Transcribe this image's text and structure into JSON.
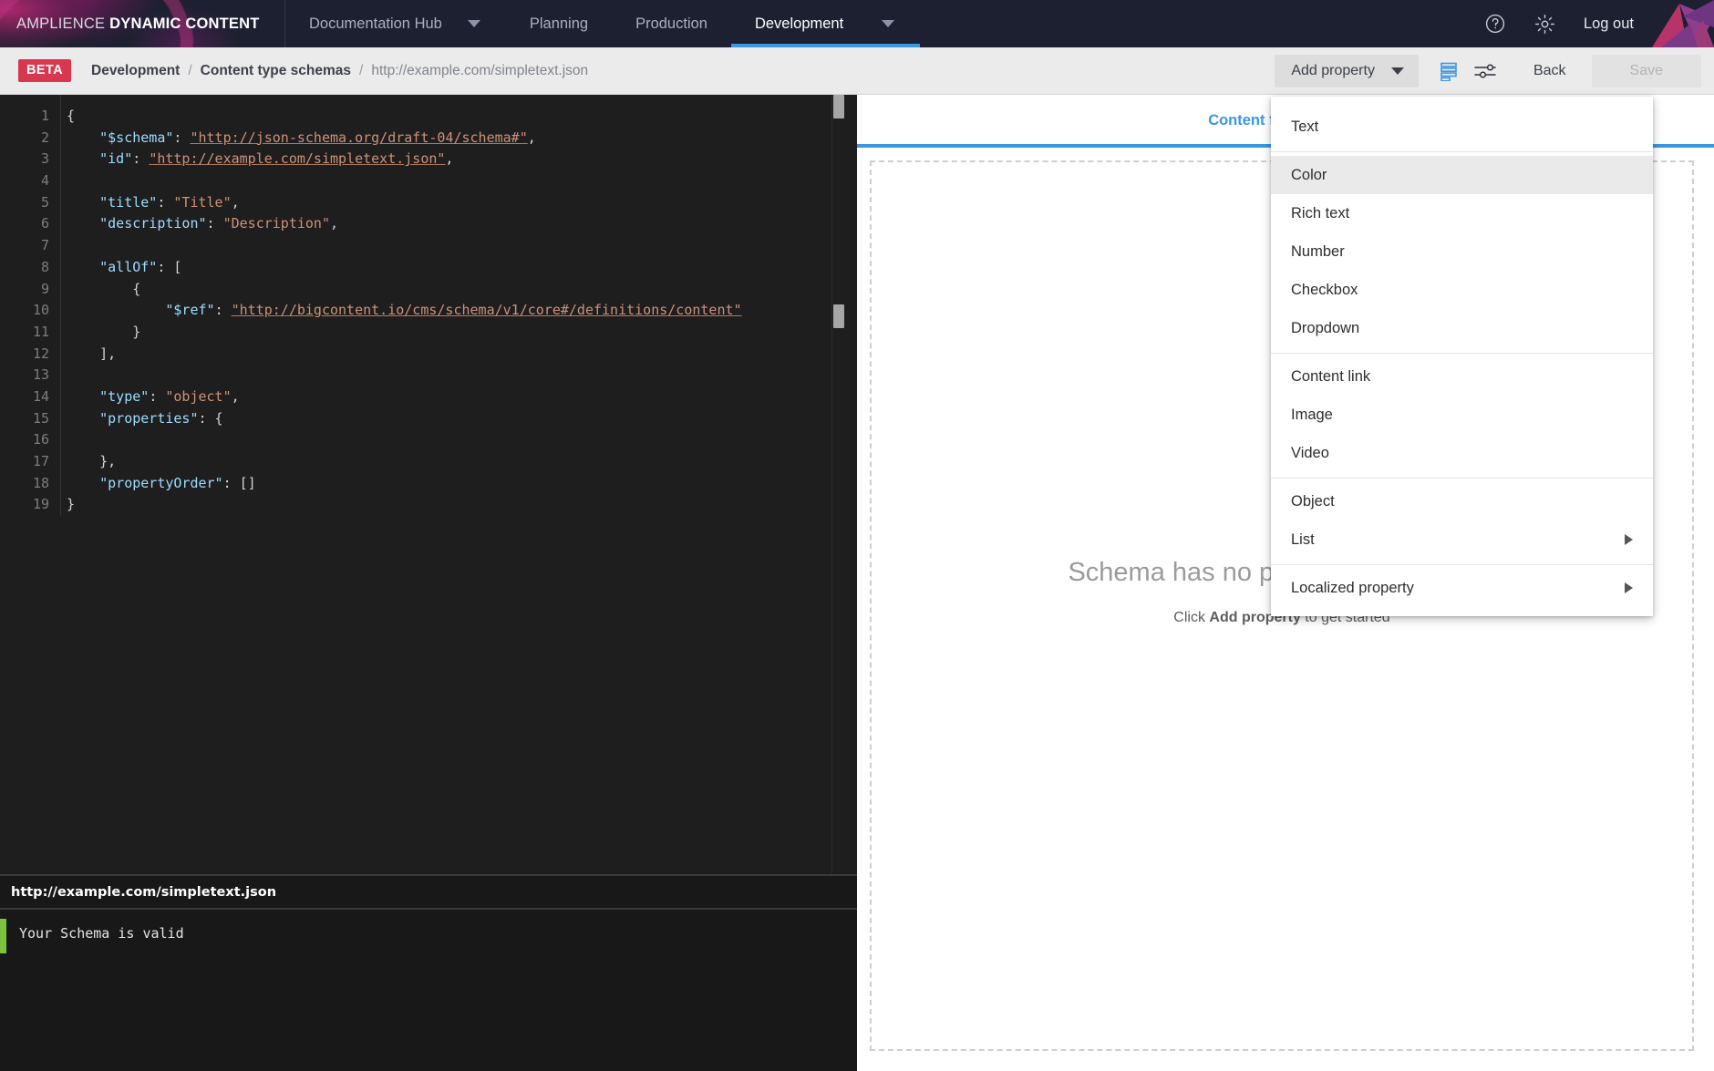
{
  "topnav": {
    "brand_thin": "AMPLIENCE",
    "brand_bold": "DYNAMIC CONTENT",
    "items": [
      {
        "label": "Documentation Hub",
        "active": false,
        "caret": true
      },
      {
        "label": "Planning",
        "active": false,
        "caret": false
      },
      {
        "label": "Production",
        "active": false,
        "caret": false
      },
      {
        "label": "Development",
        "active": true,
        "caret": true
      }
    ],
    "help_icon": "question-mark-circle-icon",
    "settings_icon": "gear-icon",
    "logout": "Log out",
    "active_color": "#3b97e3",
    "background": "#1c2030"
  },
  "crumbbar": {
    "badge": "BETA",
    "badge_color": "#d8374f",
    "crumb1": "Development",
    "sep1": "/",
    "crumb2": "Content type schemas",
    "sep2": "/",
    "current": "http://example.com/simpletext.json",
    "add_property": "Add property",
    "view_list_icon": "list-view-icon",
    "view_sliders_icon": "sliders-settings-icon",
    "back": "Back",
    "save": "Save"
  },
  "editor": {
    "line_numbers": [
      "1",
      "2",
      "3",
      "4",
      "5",
      "6",
      "7",
      "8",
      "9",
      "10",
      "11",
      "12",
      "13",
      "14",
      "15",
      "16",
      "17",
      "18",
      "19"
    ],
    "lines": [
      "{",
      "    \"$schema\": \"http://json-schema.org/draft-04/schema#\",",
      "    \"id\": \"http://example.com/simpletext.json\",",
      "",
      "    \"title\": \"Title\",",
      "    \"description\": \"Description\",",
      "",
      "    \"allOf\": [",
      "        {",
      "            \"$ref\": \"http://bigcontent.io/cms/schema/v1/core#/definitions/content\"",
      "        }",
      "    ],",
      "",
      "    \"type\": \"object\",",
      "    \"properties\": {",
      "",
      "    },",
      "    \"propertyOrder\": []",
      "}"
    ],
    "console_title": "http://example.com/simpletext.json",
    "console_message": "Your Schema is valid",
    "console_status_color": "#7cc340"
  },
  "preview": {
    "tab_label": "Content form preview",
    "empty_title": "Schema has no properties to display",
    "empty_sub_prefix": "Click ",
    "empty_sub_bold": "Add property",
    "empty_sub_suffix": " to get started"
  },
  "menu": {
    "groups": [
      {
        "items": [
          {
            "label": "Text",
            "highlighted": false,
            "submenu": false
          }
        ]
      },
      {
        "items": [
          {
            "label": "Color",
            "highlighted": true,
            "submenu": false
          },
          {
            "label": "Rich text",
            "highlighted": false,
            "submenu": false
          },
          {
            "label": "Number",
            "highlighted": false,
            "submenu": false
          },
          {
            "label": "Checkbox",
            "highlighted": false,
            "submenu": false
          },
          {
            "label": "Dropdown",
            "highlighted": false,
            "submenu": false
          }
        ]
      },
      {
        "items": [
          {
            "label": "Content link",
            "highlighted": false,
            "submenu": false
          },
          {
            "label": "Image",
            "highlighted": false,
            "submenu": false
          },
          {
            "label": "Video",
            "highlighted": false,
            "submenu": false
          }
        ]
      },
      {
        "items": [
          {
            "label": "Object",
            "highlighted": false,
            "submenu": false
          },
          {
            "label": "List",
            "highlighted": false,
            "submenu": true
          }
        ]
      },
      {
        "items": [
          {
            "label": "Localized property",
            "highlighted": false,
            "submenu": true
          }
        ]
      }
    ]
  }
}
